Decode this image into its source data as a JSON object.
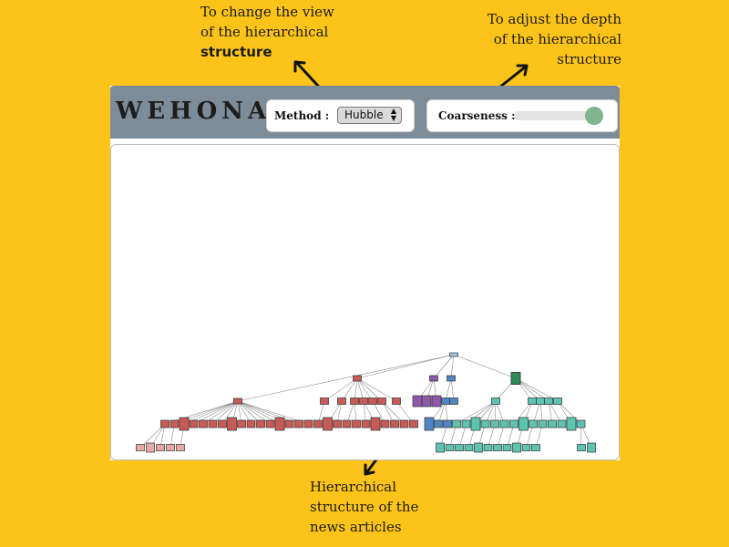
{
  "annotations": {
    "view_line1": "To change the view",
    "view_line2": "of the hierarchical",
    "view_line3": "structure",
    "depth_line1": "To adjust the depth",
    "depth_line2": "of the hierarchical",
    "depth_line3": "structure",
    "tree_line1": "Hierarchical",
    "tree_line2": "structure of the",
    "tree_line3": "news articles"
  },
  "app": {
    "logo": "WEHONA",
    "method_label": "Method :",
    "method_value": "Hubble",
    "coarseness_label": "Coarseness :",
    "coarseness_level": 0.95
  },
  "colors": {
    "background": "#FCC419",
    "header": "#7D8C99",
    "slider_thumb": "#7FB48E",
    "cluster_red": "#C85A57",
    "cluster_pink": "#E8A8A8",
    "cluster_purple": "#8E5AA8",
    "cluster_blue": "#4F85C2",
    "cluster_teal": "#5CC4B0",
    "cluster_darkgreen": "#2E8B57"
  }
}
